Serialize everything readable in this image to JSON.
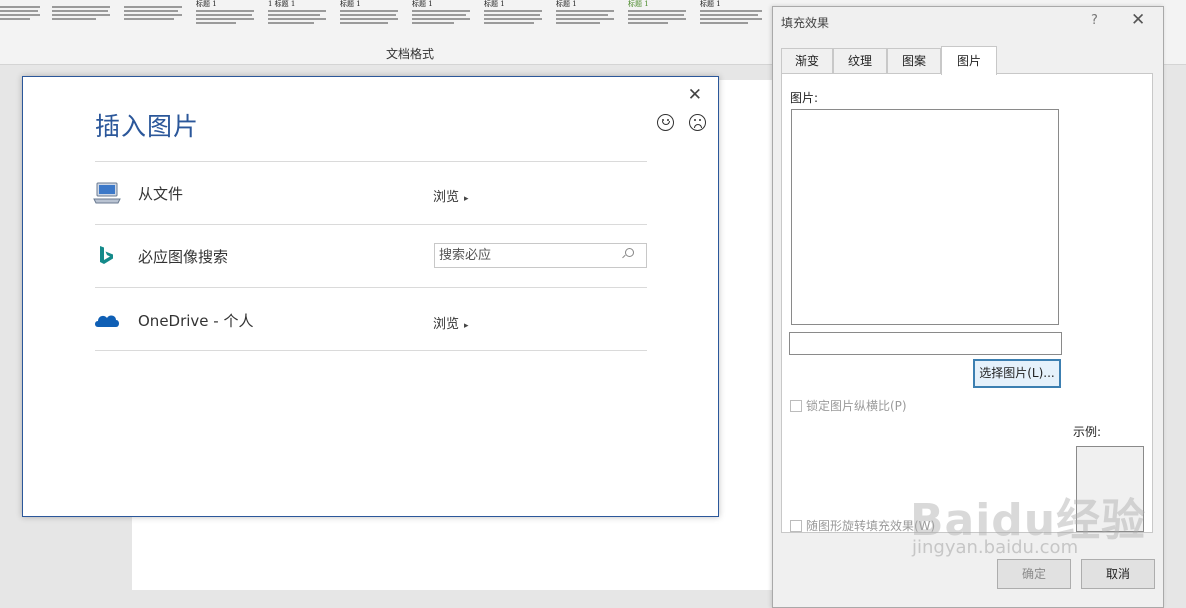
{
  "ribbon": {
    "group_label": "文档格式",
    "style_headings": [
      "",
      "",
      "",
      "标题 1",
      "1 标题 1",
      "标题 1",
      "标题 1",
      "标题 1",
      "标题 1",
      "标题 1",
      "标题 1"
    ]
  },
  "insert_picture": {
    "title": "插入图片",
    "close_symbol": "✕",
    "rows": [
      {
        "label": "从文件",
        "action": "浏览"
      },
      {
        "label": "必应图像搜索",
        "search_placeholder": "搜索必应"
      },
      {
        "label": "OneDrive - 个人",
        "action": "浏览"
      }
    ],
    "browse_arrow": "▸"
  },
  "fill_effects": {
    "title": "填充效果",
    "help_symbol": "?",
    "close_symbol": "✕",
    "tabs": [
      "渐变",
      "纹理",
      "图案",
      "图片"
    ],
    "active_tab": "图片",
    "picture_label": "图片:",
    "select_picture_button": "选择图片(L)...",
    "lock_aspect_label": "锁定图片纵横比(P)",
    "sample_label": "示例:",
    "rotate_fill_label": "随图形旋转填充效果(W)",
    "ok_button": "确定",
    "cancel_button": "取消"
  },
  "watermark": {
    "text": "Baidu经验",
    "url": "jingyan.baidu.com"
  },
  "colors": {
    "accent": "#2b579a",
    "onedrive": "#0f5fb5",
    "bing": "#148a8a"
  }
}
